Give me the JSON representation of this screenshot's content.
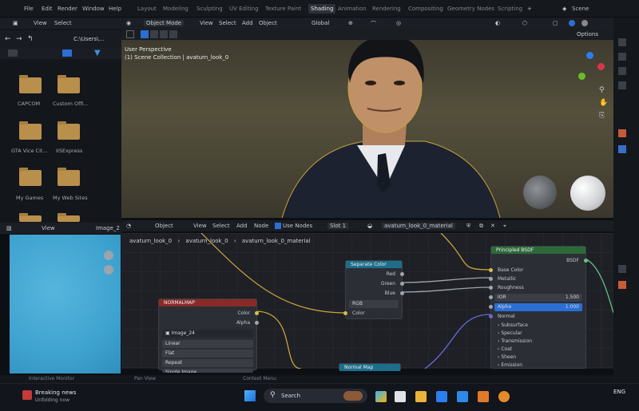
{
  "menubar": {
    "items": [
      "File",
      "Edit",
      "Render",
      "Window",
      "Help"
    ],
    "workspaces": [
      "Layout",
      "Modeling",
      "Sculpting",
      "UV Editing",
      "Texture Paint",
      "Shading",
      "Animation",
      "Rendering",
      "Compositing",
      "Geometry Nodes",
      "Scripting"
    ],
    "active_workspace": "Shading",
    "add_tab": "+",
    "scene": "Scene"
  },
  "file_browser": {
    "view_label": "View",
    "select_label": "Select",
    "path": "C:\\Users\\...",
    "folders": [
      "CAPCOM",
      "Custom Offi...",
      "GTA Vice Cit...",
      "IISExpress",
      "My Games",
      "My Web Sites"
    ]
  },
  "viewport": {
    "mode": "Object Mode",
    "menus": [
      "View",
      "Select",
      "Add",
      "Object"
    ],
    "orientation": "Global",
    "options": "Options",
    "perspective_label": "User Perspective",
    "collection_label": "(1) Scene Collection | avaturn_look_0"
  },
  "node_header": {
    "type": "Object",
    "menus": [
      "View",
      "Select",
      "Add",
      "Node"
    ],
    "use_nodes": "Use Nodes",
    "slot": "Slot 1",
    "material": "avaturn_look_0_material"
  },
  "breadcrumb": [
    "avaturn_look_0",
    "avaturn_look_0",
    "avaturn_look_0_material"
  ],
  "image_editor": {
    "view_label": "View",
    "image_label": "Image_2"
  },
  "nodes": {
    "normal_map_image": {
      "title": "NORMALMAP",
      "outputs": [
        "Color",
        "Alpha"
      ],
      "image": "Image_24",
      "interpolation": "Linear",
      "projection": "Flat",
      "extension": "Repeat",
      "source": "Single Image"
    },
    "separate_color": {
      "title": "Separate Color",
      "outputs": [
        "Red",
        "Green",
        "Blue"
      ],
      "mode": "RGB",
      "input": "Color"
    },
    "principled": {
      "title": "Principled BSDF",
      "output": "BSDF",
      "inputs": [
        "Base Color",
        "Metallic",
        "Roughness"
      ],
      "ior_label": "IOR",
      "ior_value": "1.500",
      "alpha_label": "Alpha",
      "alpha_value": "1.000",
      "normal": "Normal",
      "panels": [
        "Subsurface",
        "Specular",
        "Transmission",
        "Coat",
        "Sheen",
        "Emission"
      ]
    },
    "normal_map": {
      "title": "Normal Map"
    }
  },
  "status_bar": {
    "left": "Interactive Monitor",
    "middle": "Pan View",
    "right": "Context Menu"
  },
  "taskbar": {
    "news_title": "Breaking news",
    "news_sub": "Unfolding now",
    "search_placeholder": "Search",
    "lang": "ENG"
  },
  "colors": {
    "accent_blue": "#2b6fd6",
    "node_header_blue": "#1e6e8a",
    "node_header_red": "#8a2a26",
    "node_header_green": "#2d6a3a",
    "link_yellow": "#c8a13a",
    "socket_yellow": "#d6c04a",
    "socket_gray": "#a0a4ab",
    "socket_purple": "#6a6ad6"
  }
}
